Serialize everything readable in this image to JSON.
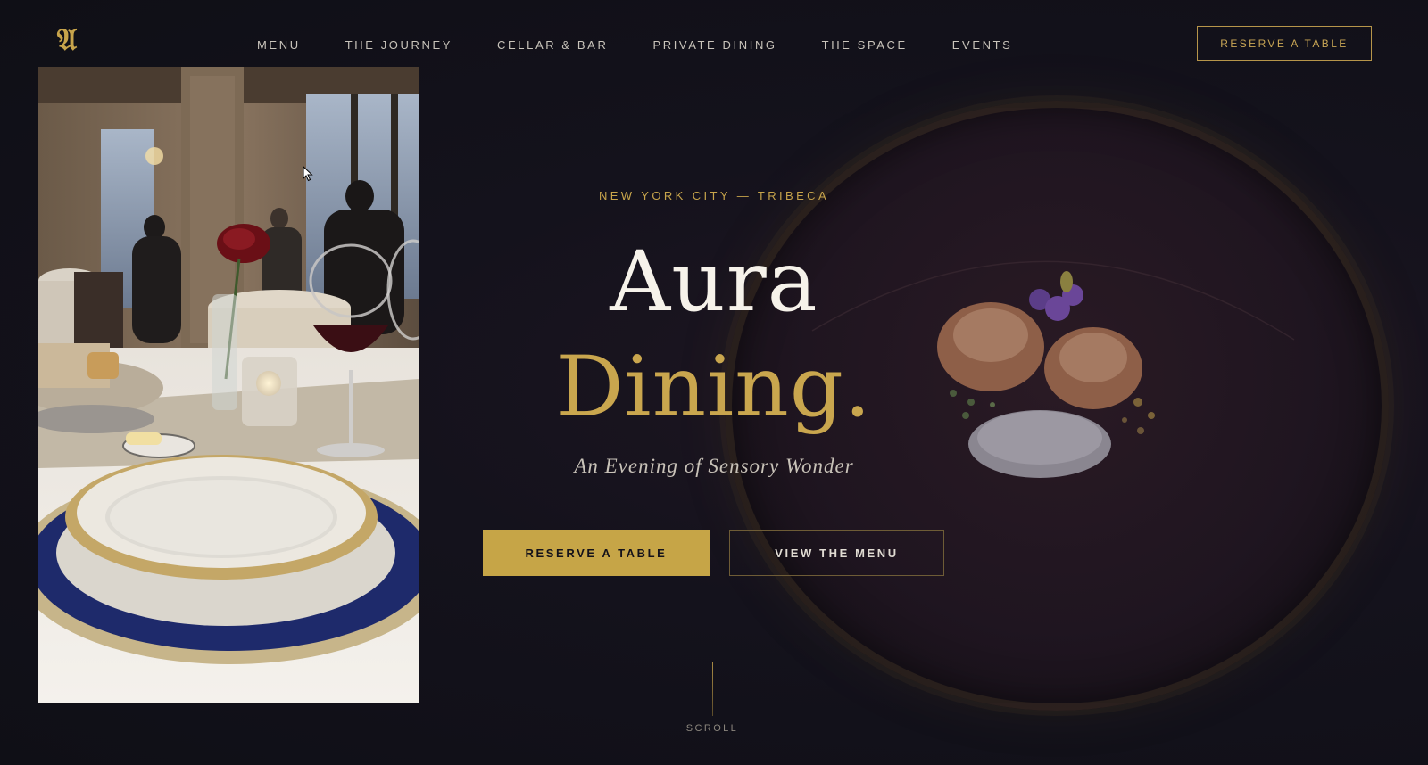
{
  "brand": {
    "logo_glyph": "𝔄",
    "accent_color": "#c6a547",
    "background_color": "#14121c"
  },
  "nav": {
    "items": [
      {
        "label": "MENU"
      },
      {
        "label": "THE JOURNEY"
      },
      {
        "label": "CELLAR & BAR"
      },
      {
        "label": "PRIVATE DINING"
      },
      {
        "label": "THE SPACE"
      },
      {
        "label": "EVENTS"
      }
    ],
    "reserve_label": "RESERVE A TABLE"
  },
  "hero": {
    "eyebrow": "NEW YORK CITY — TRIBECA",
    "title_line1": "Aura",
    "title_line2": "Dining.",
    "tagline": "An Evening of Sensory Wonder",
    "primary_cta": "RESERVE A TABLE",
    "secondary_cta": "VIEW THE MENU",
    "scroll_label": "SCROLL"
  }
}
